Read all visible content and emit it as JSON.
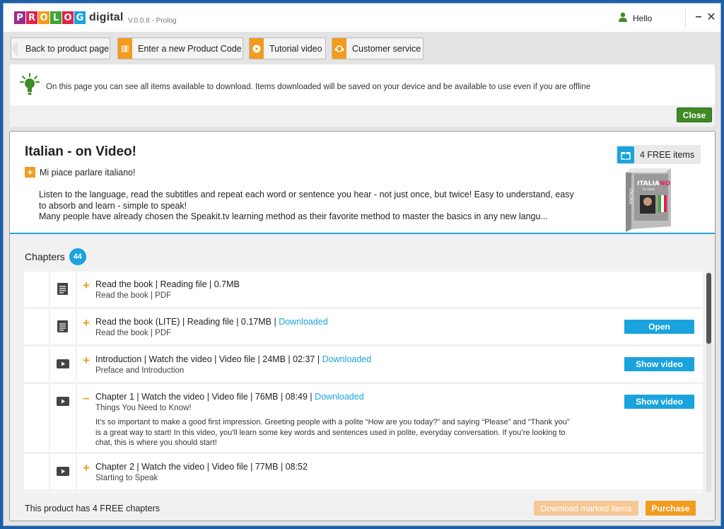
{
  "app": {
    "logo_letters": [
      {
        "ch": "P",
        "color": "#9b2b91"
      },
      {
        "ch": "R",
        "color": "#e2214d"
      },
      {
        "ch": "O",
        "color": "#f29b1f"
      },
      {
        "ch": "L",
        "color": "#3fa535"
      },
      {
        "ch": "O",
        "color": "#e2214d"
      },
      {
        "ch": "G",
        "color": "#1aa3dc"
      }
    ],
    "logo_word": "digital",
    "version": "V.0.0.8 - Prolog",
    "user_greeting": "Hello",
    "minimize": "–",
    "close": "✕"
  },
  "toolbar": {
    "back": "Back to product page",
    "product_code": "Enter a new Product Code",
    "tutorial": "Tutorial video",
    "customer_service": "Customer service"
  },
  "info": {
    "text": "On this page you can see all items available to download. Items downloaded will be saved on your device and be available to use even if you are offline",
    "close_label": "Close"
  },
  "product": {
    "title": "Italian - on Video!",
    "subtitle": "Mi piace parlare italiano!",
    "description": "Listen to the language, read the subtitles and repeat each word or sentence you hear - not just once, but twice! Easy to understand, easy to absorb and learn - simple to speak!\nMany people have already chosen the Speakit.tv learning method as their favorite method to master the basics in any new langu...",
    "free_items": "4 FREE items",
    "box_title": "ITALIANO",
    "box_sub": "on Video",
    "box_spine": "ITALIAN"
  },
  "chapters": {
    "label": "Chapters",
    "count": "44",
    "items": [
      {
        "sign": "+",
        "title": "Read the book | Reading file | 0.7MB",
        "downloaded": "",
        "sub": "Read the book | PDF",
        "desc": "",
        "action": "",
        "type": "doc"
      },
      {
        "sign": "+",
        "title": "Read the book (LITE) | Reading file | 0.17MB |",
        "downloaded": "Downloaded",
        "sub": "Read the book | PDF",
        "desc": "",
        "action": "Open",
        "type": "doc"
      },
      {
        "sign": "+",
        "title": "Introduction | Watch the video | Video file | 24MB | 02:37 |",
        "downloaded": "Downloaded",
        "sub": "Preface and Introduction",
        "desc": "",
        "action": "Show video",
        "type": "video"
      },
      {
        "sign": "–",
        "title": "Chapter 1 | Watch the video | Video file | 76MB | 08:49 |",
        "downloaded": "Downloaded",
        "sub": "Things You Need to Know!",
        "desc": "It’s so important to make a good first impression. Greeting people with a polite “How are you today?” and saying “Please” and “Thank you” is a great way to start! In this video, you’ll learn some key words and sentences used in polite, everyday conversation. If you’re looking to chat, this is where you should start!",
        "action": "Show video",
        "type": "video"
      },
      {
        "sign": "+",
        "title": "Chapter 2 | Watch the video | Video file | 77MB | 08:52",
        "downloaded": "",
        "sub": "Starting to Speak",
        "desc": "",
        "action": "",
        "type": "video"
      }
    ]
  },
  "footer": {
    "text": "This product has 4 FREE chapters",
    "download_marked": "Download marked items",
    "purchase": "Purchase"
  },
  "colors": {
    "accent_blue": "#1aa3dc",
    "accent_orange": "#f29b1f",
    "close_green": "#3f8a24"
  }
}
